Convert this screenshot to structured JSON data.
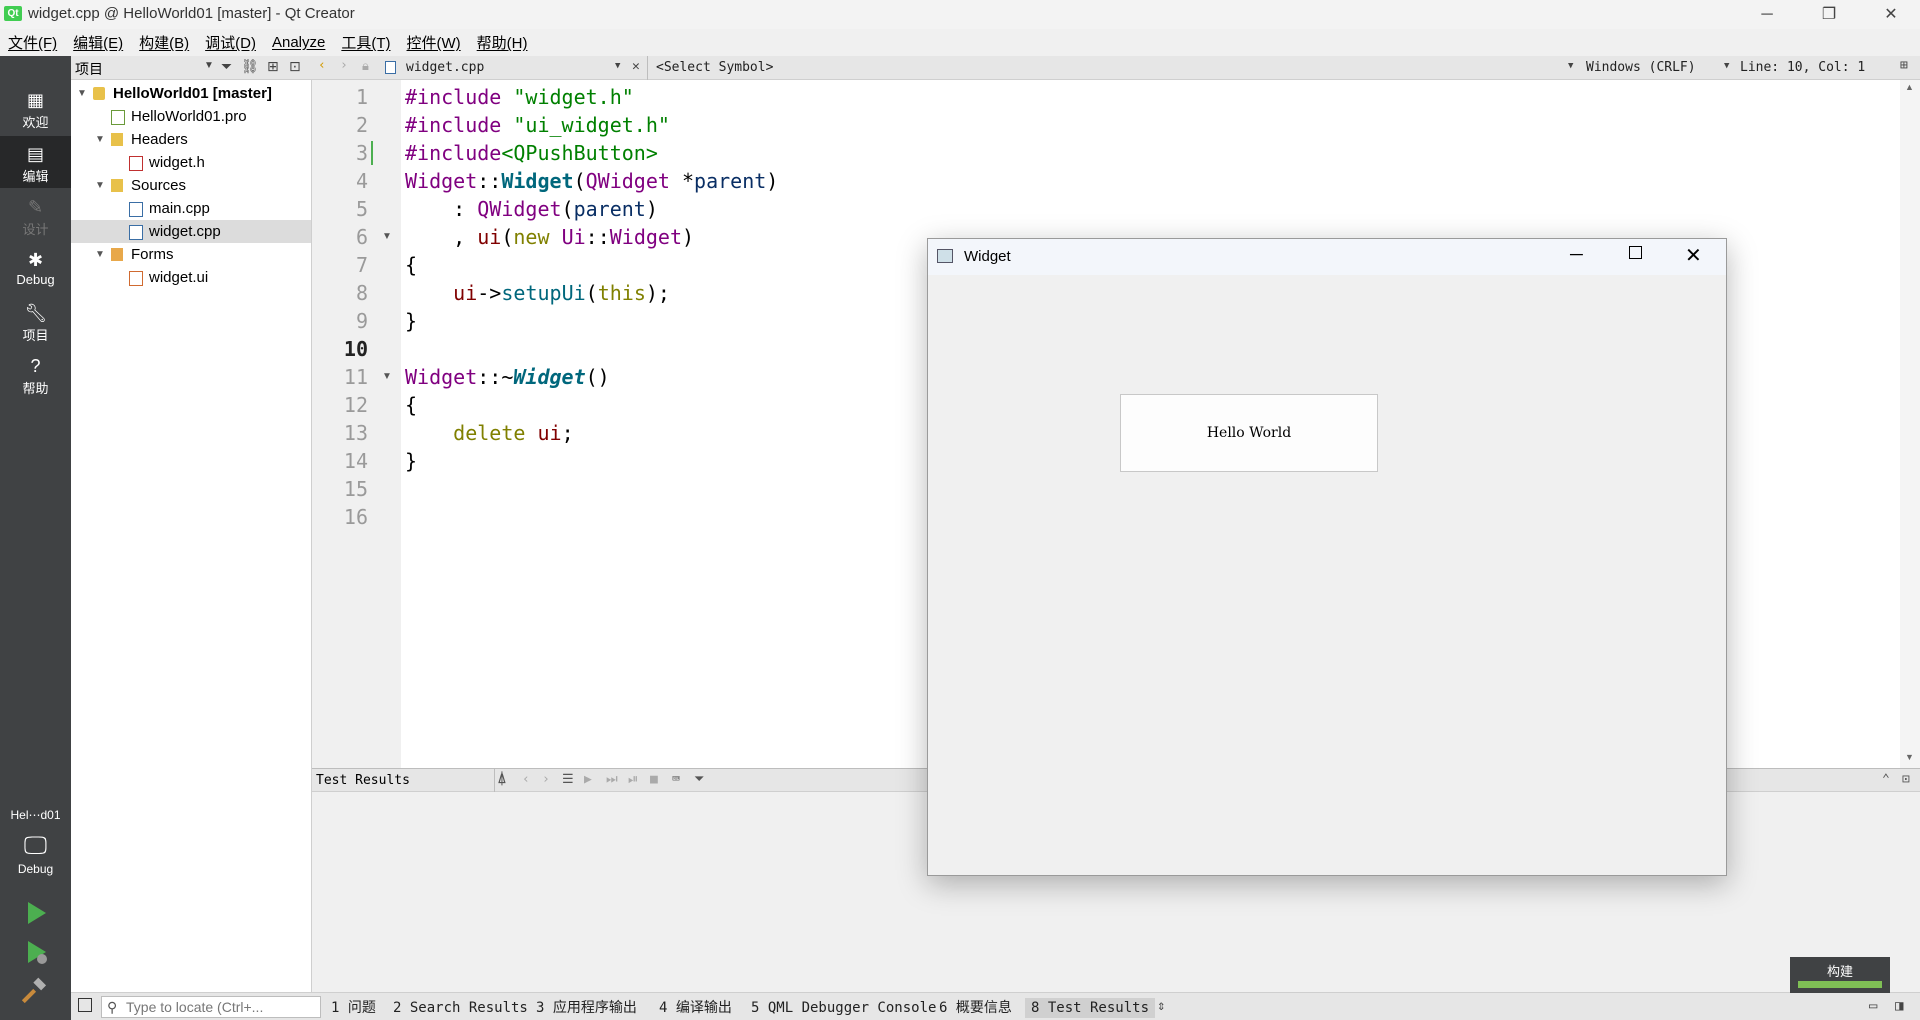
{
  "window": {
    "title": "widget.cpp @ HelloWorld01 [master] - Qt Creator",
    "controls": [
      "─",
      "❐",
      "✕"
    ]
  },
  "menu": [
    "文件(F)",
    "编辑(E)",
    "构建(B)",
    "调试(D)",
    "Analyze",
    "工具(T)",
    "控件(W)",
    "帮助(H)"
  ],
  "modes": [
    {
      "label": "欢迎",
      "icon": "grid-icon"
    },
    {
      "label": "编辑",
      "icon": "edit-icon"
    },
    {
      "label": "设计",
      "icon": "design-icon"
    },
    {
      "label": "Debug",
      "icon": "bug-icon"
    },
    {
      "label": "项目",
      "icon": "wrench-icon"
    },
    {
      "label": "帮助",
      "icon": "help-icon"
    }
  ],
  "kit": {
    "project": "Hel⋯d01",
    "config": "Debug"
  },
  "project_panel": {
    "title": "项目",
    "tree": [
      {
        "label": "HelloWorld01 [master]"
      },
      {
        "label": "HelloWorld01.pro"
      },
      {
        "label": "Headers"
      },
      {
        "label": "widget.h"
      },
      {
        "label": "Sources"
      },
      {
        "label": "main.cpp"
      },
      {
        "label": "widget.cpp"
      },
      {
        "label": "Forms"
      },
      {
        "label": "widget.ui"
      }
    ]
  },
  "editor": {
    "file": "widget.cpp",
    "symbol": "<Select Symbol>",
    "line_ending": "Windows (CRLF)",
    "position": "Line: 10, Col: 1",
    "line_numbers": [
      "1",
      "2",
      "3",
      "4",
      "5",
      "6",
      "7",
      "8",
      "9",
      "10",
      "11",
      "12",
      "13",
      "14",
      "15",
      "16"
    ]
  },
  "output_pane": {
    "title": "Test Results"
  },
  "statusbar": {
    "locate_placeholder": "Type to locate (Ctrl+...",
    "tabs": [
      "1 问题",
      "2 Search Results",
      "3 应用程序输出",
      "4 编译输出",
      "5 QML Debugger Console",
      "6 概要信息",
      "8 Test Results"
    ]
  },
  "build": {
    "label": "构建"
  },
  "widget_window": {
    "title": "Widget",
    "button_label": "Hello World"
  }
}
